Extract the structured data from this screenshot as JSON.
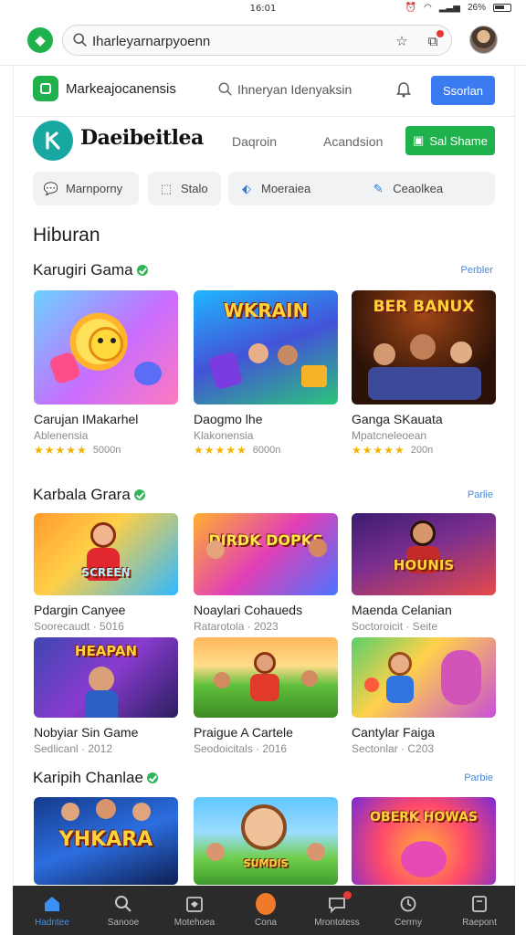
{
  "status_bar": {
    "time": "16:01",
    "battery": "26%"
  },
  "browser": {
    "url": "Iharleyarnarpyoenn",
    "icons": [
      "lock-icon",
      "star-icon",
      "tabs-icon",
      "profile-avatar"
    ]
  },
  "site_header": {
    "name": "Markeajocanensis",
    "search_placeholder": "Ihneryan Idenyaksin",
    "signin_label": "Ssorlan"
  },
  "brand_bar": {
    "name": "Daeibeitlea",
    "link_1": "Daqroin",
    "link_2": "Acandsion",
    "cta_label": "Sal Shame"
  },
  "chips": [
    {
      "label": "Marnporny",
      "icon": "chat-icon"
    },
    {
      "label": "Stalo",
      "icon": "bookmark-icon"
    },
    {
      "label": "Moeraiea",
      "icon": "tag-icon"
    },
    {
      "label": "Ceaolkea",
      "icon": "pencil-icon"
    }
  ],
  "page_heading": "Hiburan",
  "sections": [
    {
      "title": "Karugiri Gama",
      "see_all": "Perbler",
      "cards": [
        {
          "title": "Carujan IMakarhel",
          "subtitle": "Ablenensia",
          "stars": "★★★★★",
          "count": "5000n",
          "art": "sun"
        },
        {
          "title": "Daogmo lhe",
          "subtitle": "Klakonensia",
          "stars": "★★★★★",
          "count": "6000n",
          "art": "wkrain",
          "art_label": "WKRAIN"
        },
        {
          "title": "Ganga SKauata",
          "subtitle": "Mpatcneleoean",
          "stars": "★★★★★",
          "count": "200n",
          "art": "ber",
          "art_label": "BER BANUX"
        }
      ]
    },
    {
      "title": "Karbala Grara",
      "see_all": "Parlie",
      "cards": [
        {
          "title": "Pdargin Canyee",
          "subtitle": "Soorecaudt · 5016",
          "art": "screen",
          "art_label": "SCREEN"
        },
        {
          "title": "Noaylari Cohaueds",
          "subtitle": "Ratarotola · 2023",
          "art": "dirdk",
          "art_label": "DIRDK DOPKS"
        },
        {
          "title": "Maenda Celanian",
          "subtitle": "Soctoroicit · Seite",
          "art": "hounis",
          "art_label": "HOUNIS"
        },
        {
          "title": "Nobyiar Sin Game",
          "subtitle": "Sedlicanl · 2012",
          "art": "heapan",
          "art_label": "HEAPAN"
        },
        {
          "title": "Praigue A Cartele",
          "subtitle": "Seodoicitals · 2016",
          "art": "field"
        },
        {
          "title": "Cantylar Faiga",
          "subtitle": "Sectonlar · C203",
          "art": "dragon"
        }
      ]
    },
    {
      "title": "Karipih Chanlae",
      "see_all": "Parbie",
      "cards": [
        {
          "art": "yhkara",
          "art_label": "YHKARA"
        },
        {
          "art": "kids",
          "art_label": "SUMDIS"
        },
        {
          "art": "oberk",
          "art_label": "OBERK HOWAS"
        }
      ]
    }
  ],
  "bottom_nav": [
    {
      "label": "Hadntee",
      "icon": "home-icon",
      "active": true
    },
    {
      "label": "Sanooe",
      "icon": "search-icon"
    },
    {
      "label": "Motehoea",
      "icon": "gamepad-icon"
    },
    {
      "label": "Cona",
      "icon": "orange-circle-icon"
    },
    {
      "label": "Mrontotess",
      "icon": "chat-icon",
      "badge": true
    },
    {
      "label": "Cerrny",
      "icon": "history-icon"
    },
    {
      "label": "Raepont",
      "icon": "folder-icon"
    }
  ],
  "colors": {
    "green": "#1fb14b",
    "blue": "#3b7bf2",
    "teal": "#18a7a1",
    "nav_bg": "#2b2b2b",
    "star": "#f2b400"
  }
}
